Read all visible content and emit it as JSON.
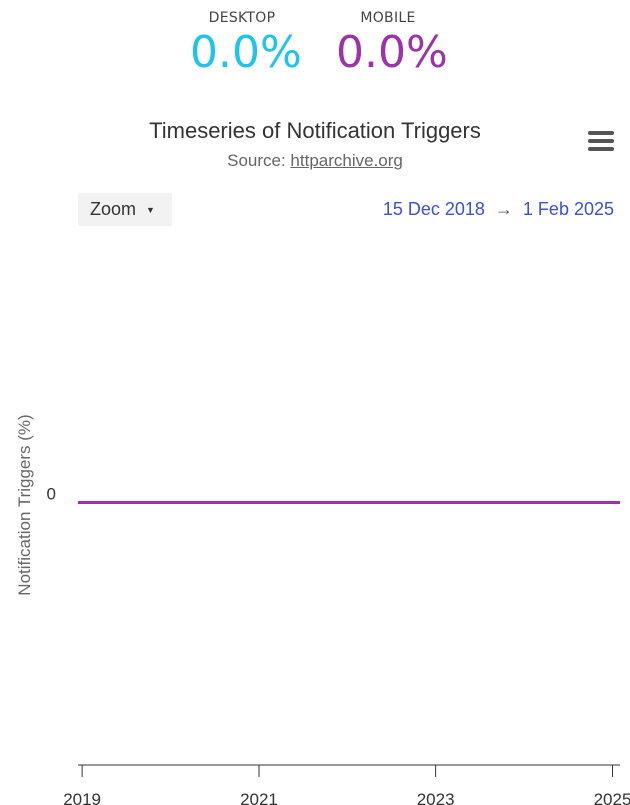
{
  "kpis": {
    "desktop": {
      "label": "DESKTOP",
      "value": "0.0%",
      "color": "#1ec4ea"
    },
    "mobile": {
      "label": "MOBILE",
      "value": "0.0%",
      "color": "#9c33a8"
    }
  },
  "toolbar": {
    "zoom_label": "Zoom",
    "range_start": "15 Dec 2018",
    "range_arrow": "→",
    "range_end": "1 Feb 2025"
  },
  "chart_data": {
    "type": "line",
    "title": "Timeseries of Notification Triggers",
    "source_prefix": "Source: ",
    "source_link": "httparchive.org",
    "ylabel": "Notification Triggers (%)",
    "xlabel": "",
    "y_tick_labels": [
      "0"
    ],
    "x_tick_labels": [
      "2019",
      "2021",
      "2023",
      "2025"
    ],
    "x_ticks": [
      "2019-01-01",
      "2021-01-01",
      "2023-01-01",
      "2025-01-01"
    ],
    "xlim": [
      "2018-12-15",
      "2025-02-01"
    ],
    "ylim": [
      -1,
      1
    ],
    "grid": false,
    "series": [
      {
        "color": "#1ec4ea",
        "x": [
          "2018-12-15",
          "2025-02-01"
        ],
        "y": [
          0,
          0
        ]
      },
      {
        "color": "#9c33a8",
        "x": [
          "2018-12-15",
          "2025-02-01"
        ],
        "y": [
          0,
          0
        ]
      }
    ]
  }
}
